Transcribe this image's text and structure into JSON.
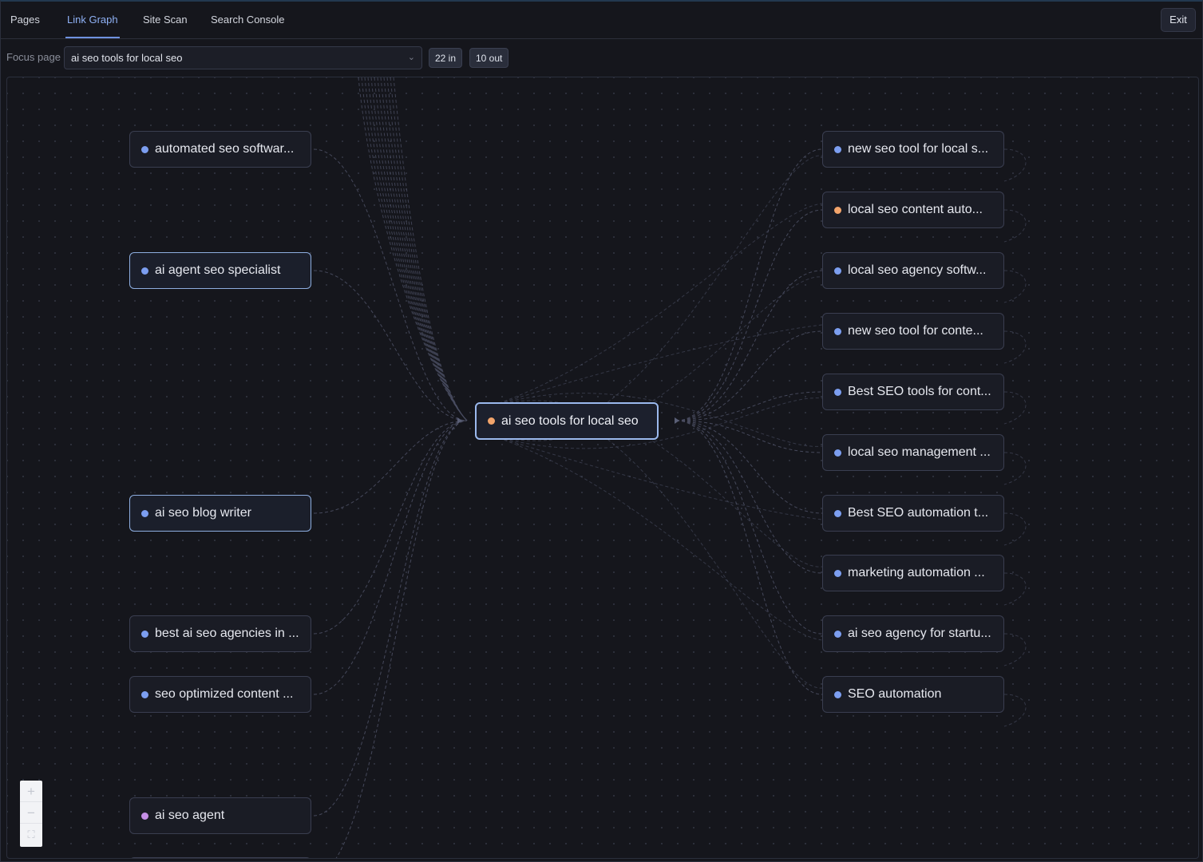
{
  "tabs": [
    {
      "label": "Pages",
      "active": false
    },
    {
      "label": "Link Graph",
      "active": true
    },
    {
      "label": "Site Scan",
      "active": false
    },
    {
      "label": "Search Console",
      "active": false
    }
  ],
  "exit_label": "Exit",
  "focus": {
    "label": "Focus page",
    "selected": "ai seo tools for local seo",
    "in_count": "22 in",
    "out_count": "10 out"
  },
  "center_node": {
    "label": "ai seo tools for local seo",
    "dot_color": "#f2a46b"
  },
  "left_nodes": [
    {
      "label": "automated seo softwar...",
      "dot_color": "#7c9ef0"
    },
    {
      "label": "ai agent seo specialist",
      "dot_color": "#7c9ef0"
    },
    {
      "label": "ai seo blog writer",
      "dot_color": "#7c9ef0"
    },
    {
      "label": "best ai seo agencies in ...",
      "dot_color": "#7c9ef0"
    },
    {
      "label": "seo optimized content ...",
      "dot_color": "#7c9ef0"
    },
    {
      "label": "ai seo agent",
      "dot_color": "#c58fe6"
    }
  ],
  "right_nodes": [
    {
      "label": "new seo tool for local s...",
      "dot_color": "#7c9ef0"
    },
    {
      "label": "local seo content auto...",
      "dot_color": "#f2a46b"
    },
    {
      "label": "local seo agency softw...",
      "dot_color": "#7c9ef0"
    },
    {
      "label": "new seo tool for conte...",
      "dot_color": "#7c9ef0"
    },
    {
      "label": "Best SEO tools for cont...",
      "dot_color": "#7c9ef0"
    },
    {
      "label": "local seo management ...",
      "dot_color": "#7c9ef0"
    },
    {
      "label": "Best SEO automation t...",
      "dot_color": "#7c9ef0"
    },
    {
      "label": "marketing automation ...",
      "dot_color": "#7c9ef0"
    },
    {
      "label": "ai seo agency for startu...",
      "dot_color": "#7c9ef0"
    },
    {
      "label": "SEO automation",
      "dot_color": "#7c9ef0"
    }
  ],
  "zoom_controls": {
    "zoom_in": "+",
    "zoom_out": "−",
    "fit": "⛶"
  },
  "colors": {
    "accent": "#8fb1f5",
    "edge": "#4a4e62"
  }
}
